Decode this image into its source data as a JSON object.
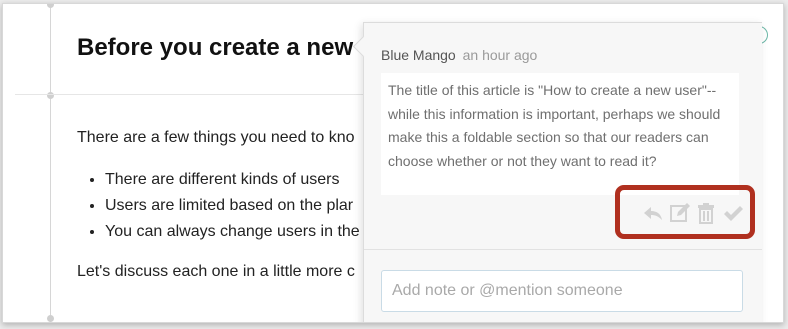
{
  "article": {
    "title": "Before you create a new u",
    "intro": "There are a few things you need to kno",
    "bullets": [
      "There are different kinds of users",
      "Users are limited based on the plar",
      "You can always change users in the"
    ],
    "closing": "Let's discuss each one in a little more c"
  },
  "comment": {
    "author": "Blue Mango",
    "time": "an hour ago",
    "body": "The title of this article is \"How to create a new user\"-- while this information is important, perhaps we should make this a foldable section so that our readers can choose whether or not they want to read it?",
    "actions": [
      {
        "name": "reply",
        "icon": "reply-icon"
      },
      {
        "name": "edit",
        "icon": "edit-icon"
      },
      {
        "name": "delete",
        "icon": "trash-icon"
      },
      {
        "name": "resolve",
        "icon": "checkmark-icon"
      }
    ],
    "highlight_color": "#b0301f"
  },
  "note_input": {
    "placeholder": "Add note or @mention someone",
    "value": ""
  }
}
